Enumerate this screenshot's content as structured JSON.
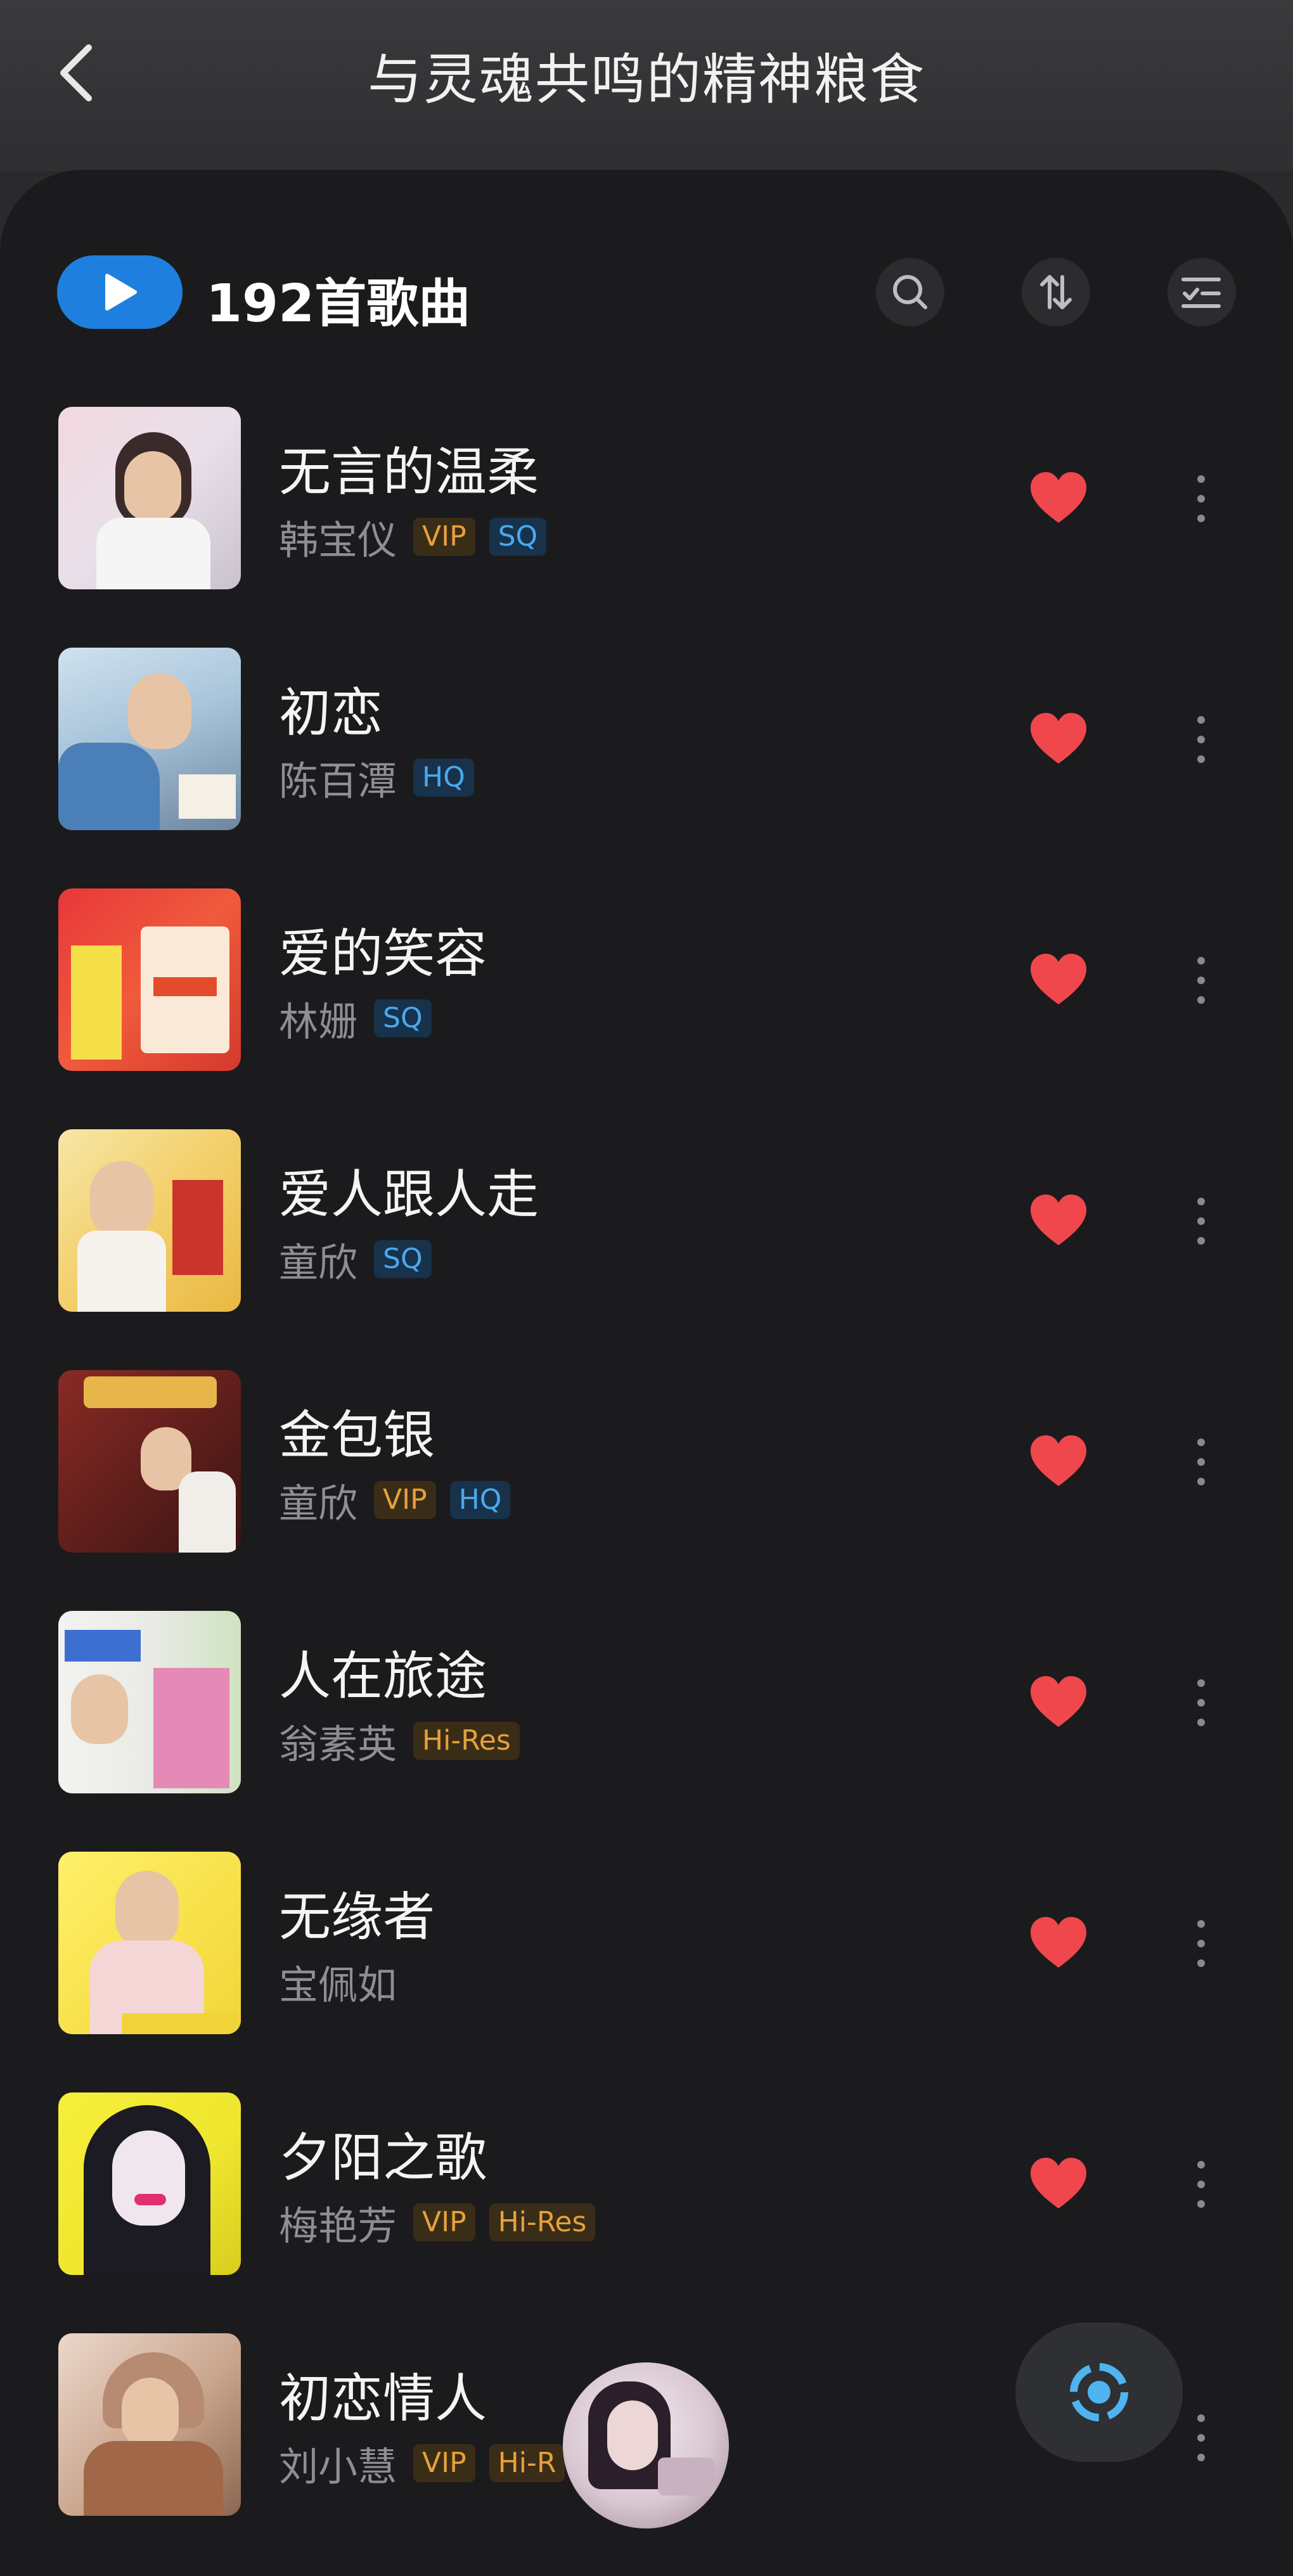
{
  "header": {
    "title": "与灵魂共鸣的精神粮食"
  },
  "list_header": {
    "count_label": "192首歌曲"
  },
  "colors": {
    "accent": "#1f7fdf",
    "heart": "#f0474d",
    "vip": "#e6a13a",
    "quality": "#4aa8ee"
  },
  "icons": {
    "back": "back-arrow-icon",
    "play": "play-icon",
    "search": "search-icon",
    "sort": "sort-icon",
    "multiselect": "multiselect-icon",
    "heart": "heart-icon",
    "more": "more-vertical-icon",
    "locate": "locate-current-icon"
  },
  "songs": [
    {
      "title": "无言的温柔",
      "artist": "韩宝仪",
      "badges": [
        "VIP",
        "SQ"
      ]
    },
    {
      "title": "初恋",
      "artist": "陈百潭",
      "badges": [
        "HQ"
      ]
    },
    {
      "title": "爱的笑容",
      "artist": "林姗",
      "badges": [
        "SQ"
      ]
    },
    {
      "title": "爱人跟人走",
      "artist": "童欣",
      "badges": [
        "SQ"
      ]
    },
    {
      "title": "金包银",
      "artist": "童欣",
      "badges": [
        "VIP",
        "HQ"
      ]
    },
    {
      "title": "人在旅途",
      "artist": "翁素英",
      "badges": [
        "Hi-Res"
      ]
    },
    {
      "title": "无缘者",
      "artist": "宝佩如",
      "badges": []
    },
    {
      "title": "夕阳之歌",
      "artist": "梅艳芳",
      "badges": [
        "VIP",
        "Hi-Res"
      ]
    },
    {
      "title": "初恋情人",
      "artist": "刘小慧",
      "badges": [
        "VIP",
        "Hi-R"
      ]
    }
  ]
}
